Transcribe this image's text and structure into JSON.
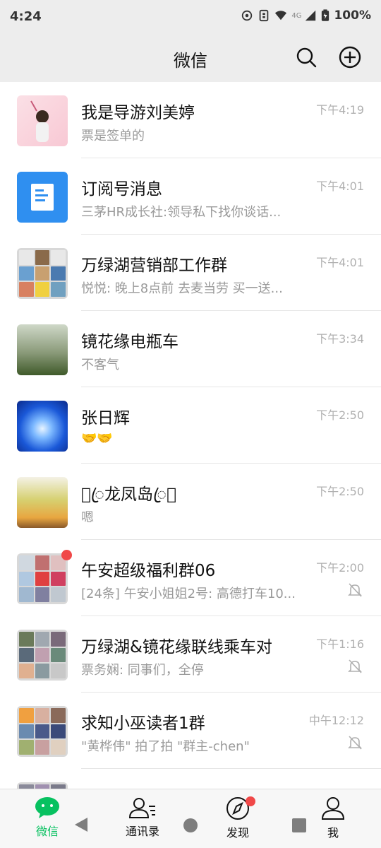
{
  "status_bar": {
    "time": "4:24",
    "network": "4G",
    "battery": "100%"
  },
  "header": {
    "title": "微信"
  },
  "chats": [
    {
      "name": "我是导游刘美婷",
      "message": "票是签单的",
      "time": "下午4:19",
      "muted": false
    },
    {
      "name": "订阅号消息",
      "message": "三茅HR成长社:领导私下找你谈话...",
      "time": "下午4:01",
      "muted": false
    },
    {
      "name": "万绿湖营销部工作群",
      "message": "悦悦: 晚上8点前 去麦当劳 买一送...",
      "time": "下午4:01",
      "muted": false
    },
    {
      "name": "镜花缘电瓶车",
      "message": "不客气",
      "time": "下午3:34",
      "muted": false
    },
    {
      "name": "张日辉",
      "message": "🤝🤝",
      "time": "下午2:50",
      "muted": false
    },
    {
      "name": "􏰀ꦿ龙凤岛ꦿ􏰀",
      "message": "嗯",
      "time": "下午2:50",
      "muted": false
    },
    {
      "name": "午安超级福利群06",
      "message": "[24条] 午安小姐姐2号: 高德打车10...",
      "time": "下午2:00",
      "muted": true
    },
    {
      "name": "万绿湖&镜花缘联线乘车对",
      "message": "票务娴: 同事们，全停",
      "time": "下午1:16",
      "muted": true
    },
    {
      "name": "求知小巫读者1群",
      "message": "\"黄桦伟\" 拍了拍 \"群主-chen\"",
      "time": "中午12:12",
      "muted": true
    }
  ],
  "bottom_nav": {
    "chats": "微信",
    "contacts": "通讯录",
    "discover": "发现",
    "me": "我"
  },
  "colors": {
    "accent": "#07c160",
    "badge": "#f04848",
    "background": "#ededed"
  },
  "icons": {
    "search": "search-icon",
    "add": "add-circle-icon",
    "mute": "bell-off-icon",
    "doc": "document-icon"
  }
}
